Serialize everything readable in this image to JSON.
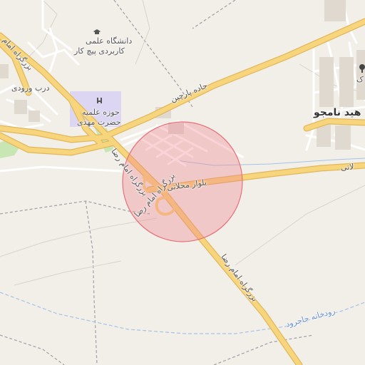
{
  "map": {
    "labels": {
      "university": "دانشگاه علمی",
      "university2": "کاربردی پیچ کار",
      "seminary": "حوزه علمیه",
      "seminary2": "حضرت مهدی",
      "darb": "درب ورودی",
      "parchin": "جاده پارچین",
      "blvd": "بلوار محلاتی",
      "blvd_right": "لاتی",
      "reza_upper": "بزرگراه امام رضا",
      "reza_mid": "بزرگراه امام رضا",
      "reza_lower": "بزرگراه امام رضا",
      "reza_topleft": "بزرگراه امام",
      "river": "رودخانه جاجرود",
      "namjoo": "هید نامجو",
      "right_letter": "ک"
    },
    "icons": [
      "graduation-cap-icon",
      "religious-school-icon",
      "tree-icon"
    ],
    "colors": {
      "background": "#f2efe9",
      "major_road": "#f7d57c",
      "major_road_casing": "#e2b75a",
      "minor_road": "#ffffff",
      "river": "#a5c3e8",
      "landuse_purple": "#dcd6f2",
      "park_green": "#c8e6b4",
      "highlight_circle": "#f0828c"
    }
  }
}
